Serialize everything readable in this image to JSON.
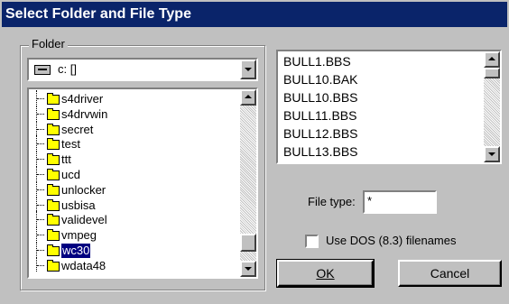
{
  "window": {
    "title": "Select Folder and File Type"
  },
  "folder_group": {
    "label": "Folder",
    "drive": {
      "value": "c: []",
      "icon": "drive-icon"
    },
    "folders": [
      {
        "name": "s4driver"
      },
      {
        "name": "s4drvwin"
      },
      {
        "name": "secret"
      },
      {
        "name": "test"
      },
      {
        "name": "ttt"
      },
      {
        "name": "ucd"
      },
      {
        "name": "unlocker"
      },
      {
        "name": "usbisa"
      },
      {
        "name": "validevel"
      },
      {
        "name": "vmpeg"
      },
      {
        "name": "wc30",
        "selected": true
      },
      {
        "name": "wdata48"
      }
    ]
  },
  "files": [
    "BULL1.BBS",
    "BULL10.BAK",
    "BULL10.BBS",
    "BULL11.BBS",
    "BULL12.BBS",
    "BULL13.BBS"
  ],
  "file_type": {
    "label": "File type:",
    "value": "*"
  },
  "dos_names": {
    "label": "Use DOS (8.3) filenames",
    "checked": false
  },
  "buttons": {
    "ok": "OK",
    "cancel": "Cancel"
  },
  "colors": {
    "title_bar": "#0a246a",
    "selection": "#000080",
    "folder": "#ffff00",
    "face": "#c0c0c0"
  }
}
